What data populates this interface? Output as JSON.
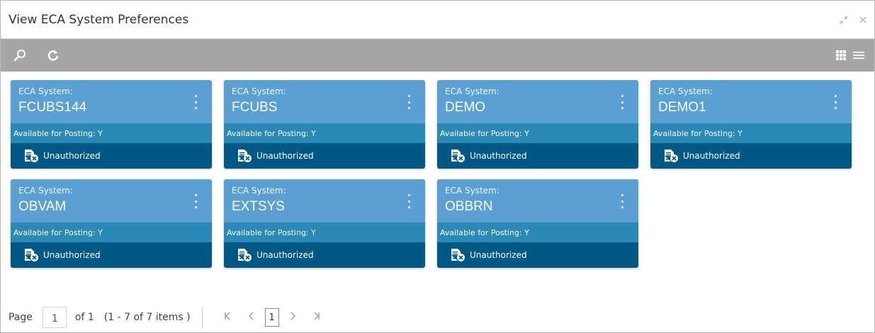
{
  "window": {
    "title": "View ECA System Preferences",
    "minimize_icon": "collapse-arrows-icon",
    "close_icon": "close-icon"
  },
  "toolbar": {
    "search_icon": "search-icon",
    "refresh_icon": "refresh-icon",
    "grid_view_icon": "grid-view-icon",
    "list_view_icon": "list-view-icon"
  },
  "colors": {
    "toolbar": "#a6a6a6",
    "card_top": "#5aa0d2",
    "card_mid": "#2a89b7",
    "card_bottom": "#005984"
  },
  "cards": [
    {
      "label": "ECA System:",
      "name": "FCUBS144",
      "posting": "Available for Posting: Y",
      "status": "Unauthorized"
    },
    {
      "label": "ECA System:",
      "name": "FCUBS",
      "posting": "Available for Posting: Y",
      "status": "Unauthorized"
    },
    {
      "label": "ECA System:",
      "name": "DEMO",
      "posting": "Available for Posting: Y",
      "status": "Unauthorized"
    },
    {
      "label": "ECA System:",
      "name": "DEMO1",
      "posting": "Available for Posting: Y",
      "status": "Unauthorized"
    },
    {
      "label": "ECA System:",
      "name": "OBVAM",
      "posting": "Available for Posting: Y",
      "status": "Unauthorized"
    },
    {
      "label": "ECA System:",
      "name": "EXTSYS",
      "posting": "Available for Posting: Y",
      "status": "Unauthorized"
    },
    {
      "label": "ECA System:",
      "name": "OBBRN",
      "posting": "Available for Posting: Y",
      "status": "Unauthorized"
    }
  ],
  "pagination": {
    "page_label": "Page",
    "page_value": "1",
    "of_label": "of 1",
    "items_label": "(1 - 7 of 7 items )",
    "current_page": "1",
    "first_icon": "K",
    "prev_icon": "<",
    "next_icon": ">",
    "last_icon": ">|"
  }
}
